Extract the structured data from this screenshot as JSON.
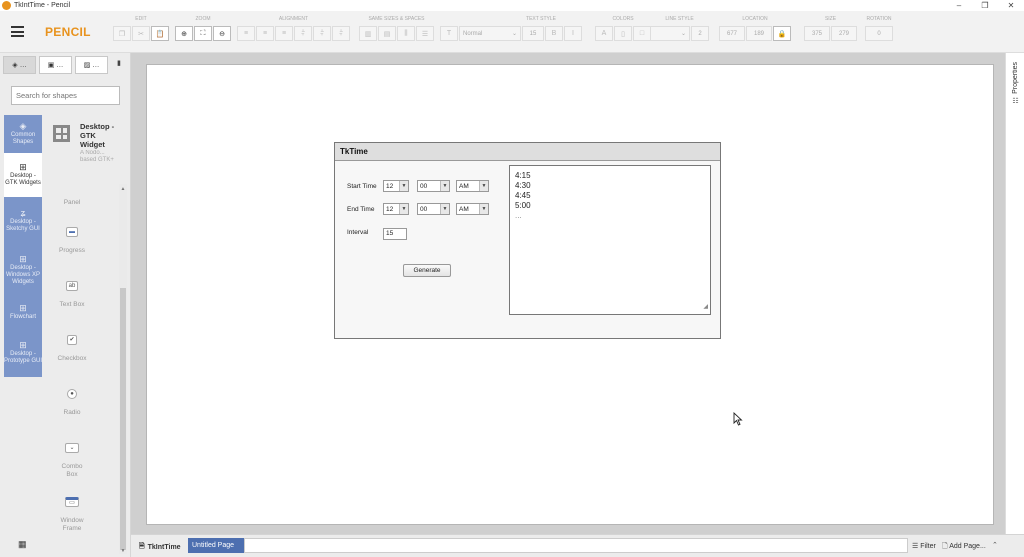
{
  "window": {
    "title": "TkIntTime - Pencil",
    "minimize": "–",
    "maximize": "❐",
    "close": "✕"
  },
  "toolbar": {
    "logo": "PENCIL",
    "groups": [
      {
        "label": "EDIT"
      },
      {
        "label": "ZOOM"
      },
      {
        "label": "ALIGNMENT"
      },
      {
        "label": "SAME SIZES & SPACES"
      },
      {
        "label": "TEXT STYLE"
      },
      {
        "label": "COLORS"
      },
      {
        "label": "LINE STYLE"
      },
      {
        "label": "LOCATION"
      },
      {
        "label": "SIZE"
      },
      {
        "label": "ROTATION"
      }
    ],
    "font_name": "Normal",
    "font_size": "15",
    "bold": "B",
    "italic": "I",
    "text_color": "A",
    "line_width": "2",
    "x": "677",
    "y": "189",
    "width": "375",
    "height": "279",
    "rotation": "0"
  },
  "left_panel": {
    "search_placeholder": "Search for shapes",
    "categories": [
      {
        "label": "Common Shapes",
        "icon": "layers-icon"
      },
      {
        "label": "Desktop - GTK Widgets",
        "icon": "grid-icon"
      },
      {
        "label": "Desktop - Sketchy GUI",
        "icon": "sketch-icon"
      },
      {
        "label": "Desktop - Windows XP Widgets",
        "icon": "grid-icon"
      },
      {
        "label": "Flowchart",
        "icon": "grid-icon"
      },
      {
        "label": "Desktop - Prototype GUI",
        "icon": "grid-icon"
      }
    ],
    "collection": {
      "title": "Desktop - GTK Widget",
      "description": "A Nodo... based GTK+"
    },
    "shapes": [
      {
        "label": "Panel",
        "icon": ""
      },
      {
        "label": "Progress",
        "icon": "▬"
      },
      {
        "label": "Text Box",
        "icon": "ab"
      },
      {
        "label": "Checkbox",
        "icon": "✔"
      },
      {
        "label": "Radio",
        "icon": "●"
      },
      {
        "label": "Combo Box",
        "icon": "⌄"
      },
      {
        "label": "Window Frame",
        "icon": "▭"
      }
    ]
  },
  "mockup": {
    "title": "TkTime",
    "start_label": "Start Time",
    "end_label": "End Time",
    "interval_label": "Interval",
    "start_hour": "12",
    "start_min": "00",
    "start_ampm": "AM",
    "end_hour": "12",
    "end_min": "00",
    "end_ampm": "AM",
    "interval": "15",
    "generate": "Generate",
    "output_lines": [
      "4:15",
      "4:30",
      "4:45",
      "5:00",
      "..."
    ]
  },
  "right_panel": {
    "properties": "Properties"
  },
  "bottom": {
    "doc_name": "TkIntTime",
    "page_name": "Untitled Page",
    "filter": "Filter",
    "add_page": "Add Page..."
  }
}
